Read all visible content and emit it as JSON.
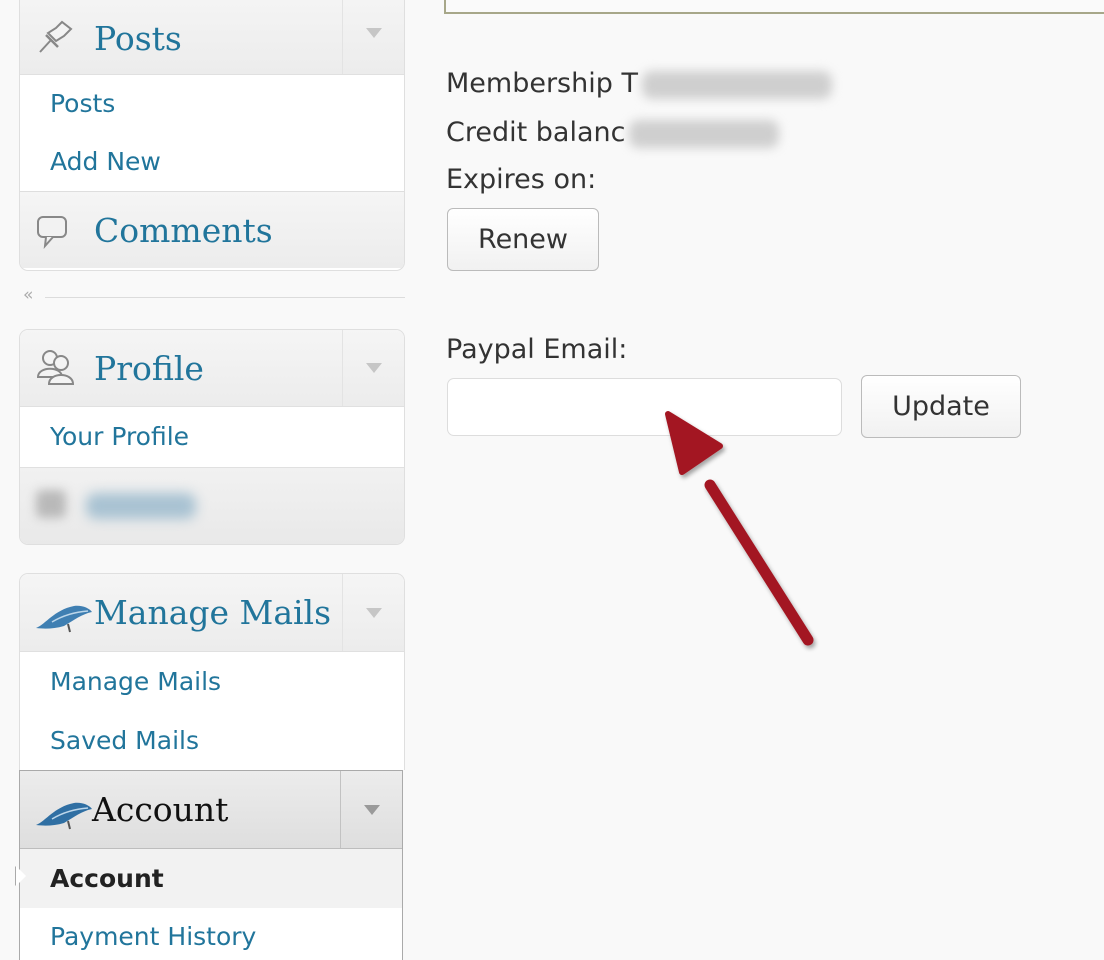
{
  "sidebar": {
    "posts": {
      "title": "Posts",
      "icon": "pushpin-icon",
      "items": [
        "Posts",
        "Add New"
      ]
    },
    "comments": {
      "title": "Comments",
      "icon": "speech-bubble-icon"
    },
    "collapse_glyph": "«",
    "profile": {
      "title": "Profile",
      "icon": "users-icon",
      "items": [
        "Your Profile"
      ]
    },
    "manage_mails": {
      "title": "Manage Mails",
      "icon": "feather-icon",
      "items": [
        "Manage Mails",
        "Saved Mails"
      ]
    },
    "account": {
      "title": "Account",
      "icon": "feather-icon",
      "items": [
        "Account",
        "Payment History"
      ],
      "active_item": "Account"
    }
  },
  "main": {
    "membership_label": "Membership T",
    "credit_label": "Credit balanc",
    "expires_label": "Expires on:",
    "renew_label": "Renew",
    "paypal_label": "Paypal Email:",
    "paypal_value": "",
    "update_label": "Update"
  },
  "colors": {
    "link": "#21759b",
    "arrow": "#a31621"
  }
}
